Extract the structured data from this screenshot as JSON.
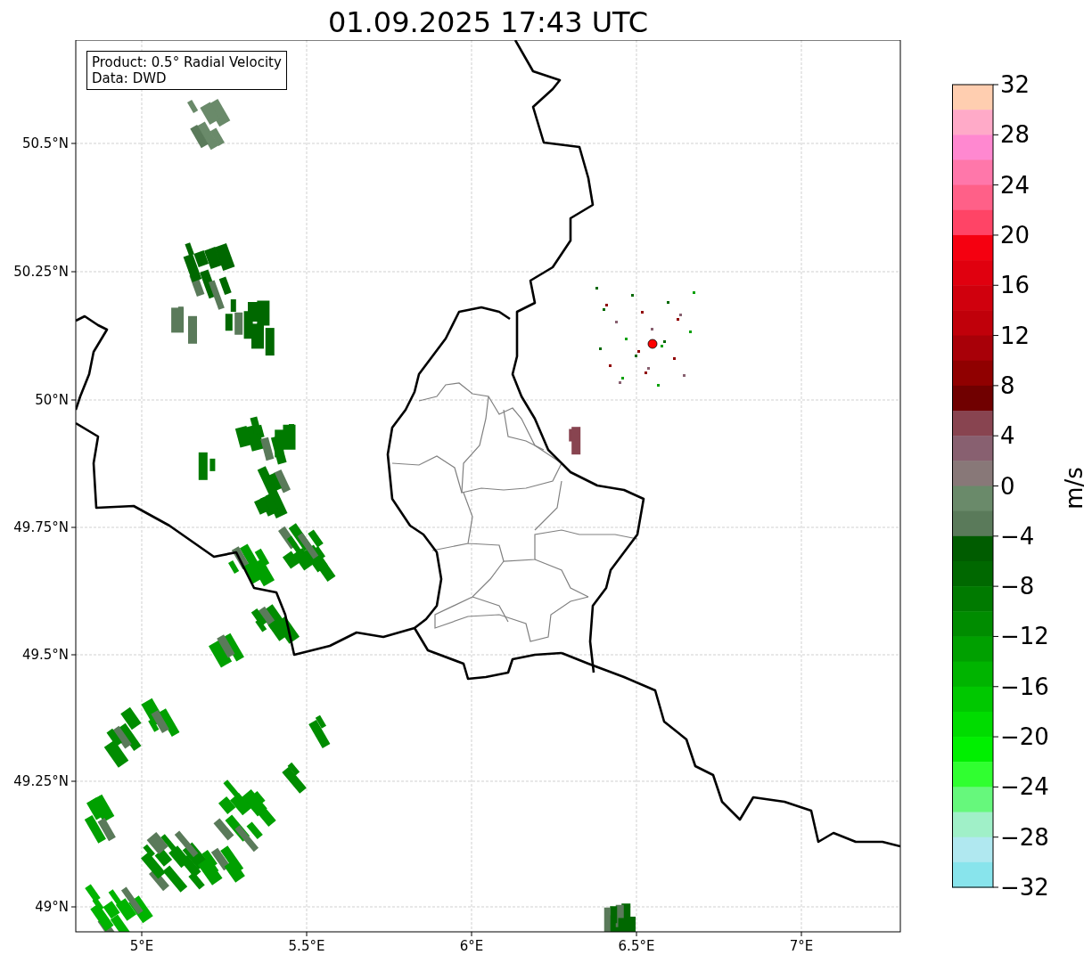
{
  "title": "01.09.2025 17:43 UTC",
  "info_box": {
    "lines": [
      "Product: 0.5° Radial Velocity",
      "Data: DWD"
    ]
  },
  "map": {
    "y_ticks": [
      "50.5°N",
      "50.25°N",
      "50°N",
      "49.75°N",
      "49.5°N",
      "49.25°N",
      "49°N"
    ],
    "x_ticks": [
      "5°E",
      "5.5°E",
      "6°E",
      "6.5°E",
      "7°E"
    ]
  },
  "colorbar": {
    "label": "m/s",
    "ticks": [
      "32",
      "28",
      "24",
      "20",
      "16",
      "12",
      "8",
      "4",
      "0",
      "−4",
      "−8",
      "−12",
      "−16",
      "−20",
      "−24",
      "−28",
      "−32"
    ],
    "segments": [
      {
        "color": "#ffceb0"
      },
      {
        "color": "#ffaac8"
      },
      {
        "color": "#ff88d0"
      },
      {
        "color": "#ff77aa"
      },
      {
        "color": "#ff6088"
      },
      {
        "color": "#ff4466"
      },
      {
        "color": "#f50010"
      },
      {
        "color": "#e0000f"
      },
      {
        "color": "#d0000d"
      },
      {
        "color": "#c0000a"
      },
      {
        "color": "#a80008"
      },
      {
        "color": "#900000"
      },
      {
        "color": "#700000"
      },
      {
        "color": "#884450"
      },
      {
        "color": "#886070"
      },
      {
        "color": "#887878"
      },
      {
        "color": "#6a8a6a"
      },
      {
        "color": "#5a7a5a"
      },
      {
        "color": "#005c00"
      },
      {
        "color": "#006800"
      },
      {
        "color": "#007a00"
      },
      {
        "color": "#008c00"
      },
      {
        "color": "#00a000"
      },
      {
        "color": "#00b400"
      },
      {
        "color": "#00c800"
      },
      {
        "color": "#00dc00"
      },
      {
        "color": "#00f000"
      },
      {
        "color": "#30ff30"
      },
      {
        "color": "#66f87c"
      },
      {
        "color": "#a0f0c8"
      },
      {
        "color": "#b0e8f0"
      },
      {
        "color": "#88e4ec"
      }
    ]
  }
}
